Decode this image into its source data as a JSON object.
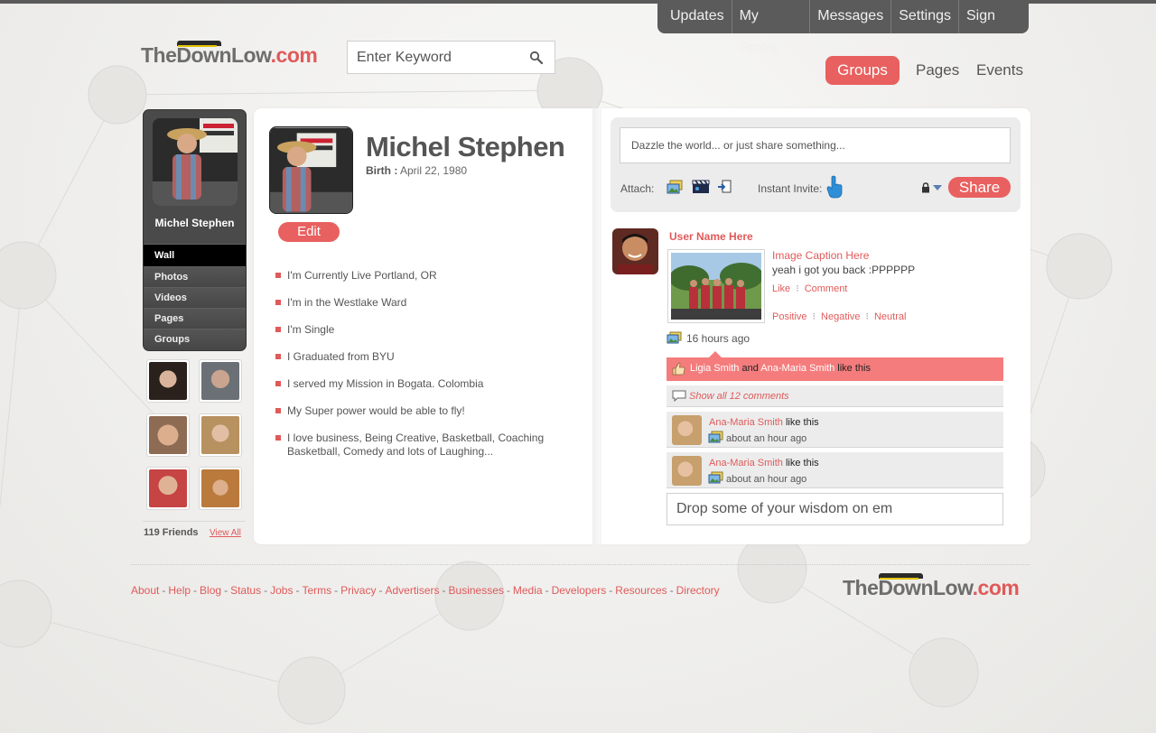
{
  "top_nav": [
    "Updates",
    "My Profile",
    "Messages",
    "Settings",
    "Sign Out"
  ],
  "logo": {
    "part1": "The",
    "part2": "Down",
    "part3": "Low",
    "part4": ".com"
  },
  "search": {
    "placeholder": "Enter Keyword"
  },
  "secondary_nav": {
    "groups": "Groups",
    "pages": "Pages",
    "events": "Events"
  },
  "sidebar": {
    "name": "Michel Stephen",
    "items": [
      "Wall",
      "Photos",
      "Videos",
      "Pages",
      "Groups"
    ]
  },
  "friends": {
    "count": "119 Friends",
    "view_all": "View All"
  },
  "profile": {
    "name": "Michel Stephen",
    "birth_label": "Birth :",
    "birth_value": "April 22, 1980",
    "edit": "Edit",
    "facts": [
      "I'm Currently Live Portland, OR",
      "I'm in the Westlake Ward",
      "I'm Single",
      "I Graduated from BYU",
      "I served my Mission in Bogata. Colombia",
      "My Super power would be able to fly!",
      "I love business, Being Creative, Basketball, Coaching Basketball, Comedy and lots of Laughing..."
    ]
  },
  "share": {
    "placeholder": "Dazzle the world... or just share something...",
    "attach": "Attach:",
    "invite": "Instant Invite:",
    "button": "Share"
  },
  "post": {
    "user": "User Name Here",
    "caption": "Image Caption Here",
    "text": "yeah i got you back :PPPPPP",
    "like": "Like",
    "comment": "Comment",
    "positive": "Positive",
    "negative": "Negative",
    "neutral": "Neutral",
    "time": "16 hours ago",
    "likes": {
      "name1": "Ligia Smith",
      "and": "and",
      "name2": "Ana-Maria Smith",
      "suffix": "like this"
    },
    "show_all": "Show all 12 comments",
    "comments": [
      {
        "name": "Ana-Maria Smith",
        "suffix": "like this",
        "time": "about an hour ago"
      },
      {
        "name": "Ana-Maria Smith",
        "suffix": "like this",
        "time": "about an hour ago"
      }
    ],
    "wisdom_placeholder": "Drop some of your wisdom on em"
  },
  "footer": {
    "links": [
      "About",
      "Help",
      "Blog",
      "Status",
      "Jobs",
      "Terms",
      "Privacy",
      "Advertisers",
      "Businesses",
      "Media",
      "Developers",
      "Resources",
      "Directory"
    ],
    "separator": "-"
  },
  "colors": {
    "accent": "#e8605f",
    "dark_nav": "#5b5b5b",
    "like_bar": "#f57c7c"
  }
}
